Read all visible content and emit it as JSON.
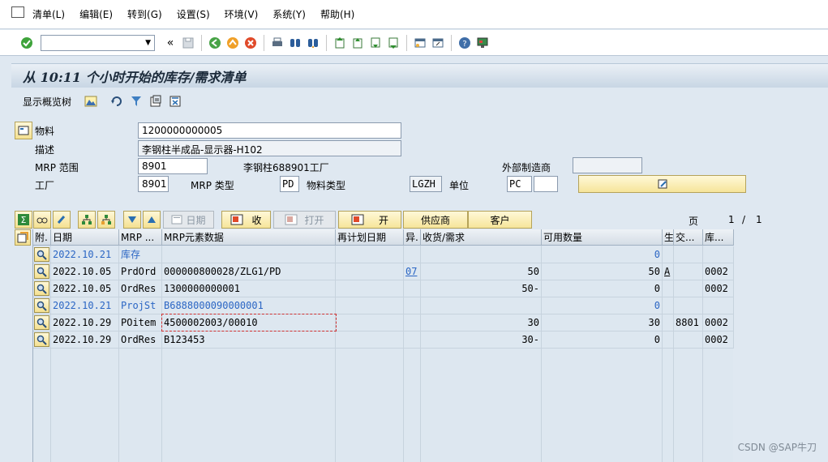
{
  "menu": [
    "清单(L)",
    "编辑(E)",
    "转到(G)",
    "设置(S)",
    "环境(V)",
    "系统(Y)",
    "帮助(H)"
  ],
  "title": "从 10:11 个小时开始的库存/需求清单",
  "app_toolbar": {
    "overview_label": "显示概览树"
  },
  "header": {
    "material_label": "物料",
    "material_value": "1200000000005",
    "desc_label": "描述",
    "desc_value": "李钢柱半成品-显示器-H102",
    "mrp_area_label": "MRP 范围",
    "mrp_area_value": "8901",
    "mrp_area_text": "李钢柱688901工厂",
    "ext_mfr_label": "外部制造商",
    "ext_mfr_value": "",
    "plant_label": "工厂",
    "plant_value": "8901",
    "mrp_type_label": "MRP 类型",
    "mrp_type_value": "PD",
    "mat_type_label": "物料类型",
    "mat_type_value": "LGZH",
    "unit_label": "单位",
    "unit_value": "PC"
  },
  "buttons": {
    "date": "日期",
    "receipt": "收",
    "open": "打开",
    "open2": "开",
    "vendor": "供应商",
    "customer": "客户"
  },
  "pager": {
    "label": "页",
    "current": "1",
    "sep": "/",
    "total": "1"
  },
  "columns": [
    "附.",
    "日期",
    "MRP ...",
    "MRP元素数据",
    "再计划日期",
    "异.",
    "收货/需求",
    "可用数量",
    "生",
    "交...",
    "库..."
  ],
  "rows": [
    {
      "date": "2022.10.21",
      "mrp": "库存",
      "data": "",
      "resched": "",
      "exc": "",
      "qty": "",
      "avail": "0",
      "s": "",
      "del": "",
      "stor": "",
      "blue": true
    },
    {
      "date": "2022.10.05",
      "mrp": "PrdOrd",
      "data": "000000800028/ZLG1/PD",
      "resched": "",
      "exc": "07",
      "qty": "50",
      "avail": "50",
      "s": "A",
      "del": "",
      "stor": "0002",
      "blue": false
    },
    {
      "date": "2022.10.05",
      "mrp": "OrdRes",
      "data": "1300000000001",
      "resched": "",
      "exc": "",
      "qty": "50-",
      "avail": "0",
      "s": "",
      "del": "",
      "stor": "0002",
      "blue": false
    },
    {
      "date": "2022.10.21",
      "mrp": "ProjSt",
      "data": "B6888000090000001",
      "resched": "",
      "exc": "",
      "qty": "",
      "avail": "0",
      "s": "",
      "del": "",
      "stor": "",
      "blue": true
    },
    {
      "date": "2022.10.29",
      "mrp": "POitem",
      "data": "4500002003/00010",
      "resched": "",
      "exc": "",
      "qty": "30",
      "avail": "30",
      "s": "",
      "del": "8801",
      "stor": "0002",
      "blue": false
    },
    {
      "date": "2022.10.29",
      "mrp": "OrdRes",
      "data": "B123453",
      "resched": "",
      "exc": "",
      "qty": "30-",
      "avail": "0",
      "s": "",
      "del": "",
      "stor": "0002",
      "blue": false
    }
  ],
  "watermark": "CSDN @SAP牛刀"
}
